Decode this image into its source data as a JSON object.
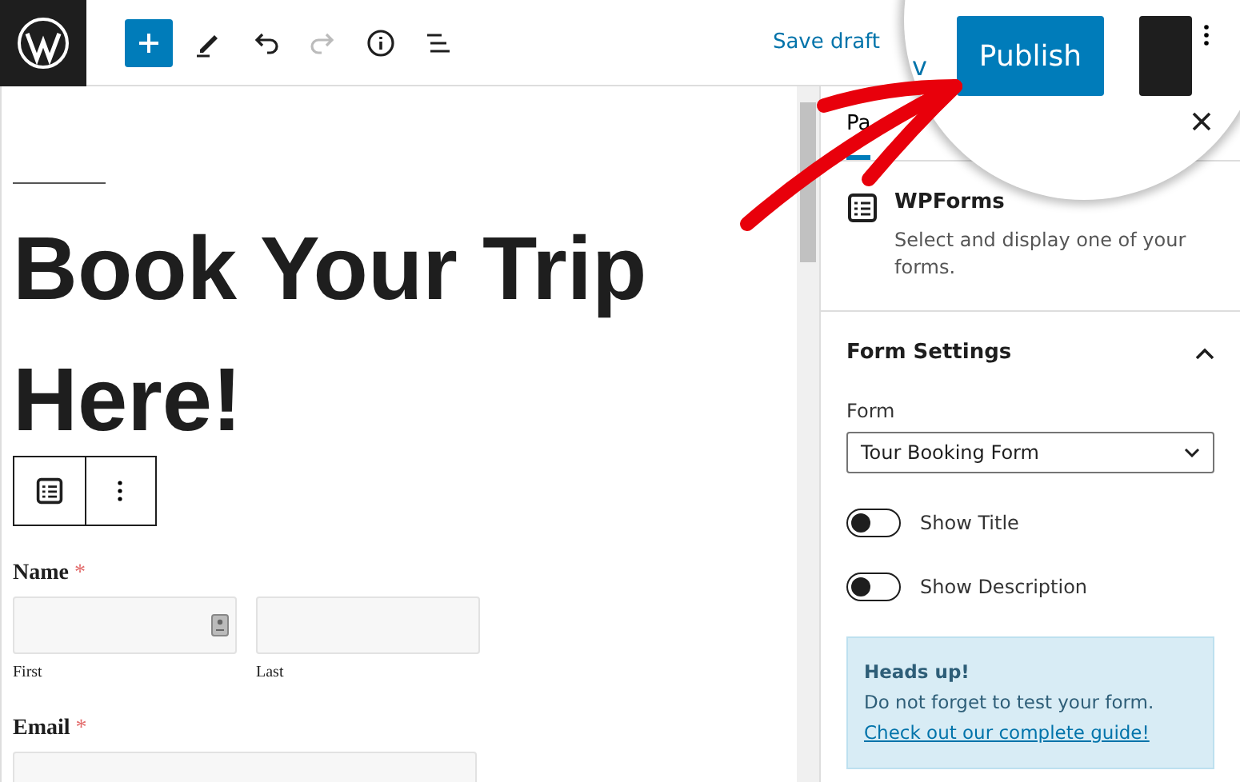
{
  "topbar": {
    "tools": [
      {
        "kind": "add"
      },
      {
        "kind": "edit"
      },
      {
        "kind": "undo",
        "disabled": false
      },
      {
        "kind": "redo",
        "disabled": true
      },
      {
        "kind": "info"
      },
      {
        "kind": "outline"
      }
    ],
    "save_draft": "Save draft"
  },
  "magnifier": {
    "preview_fragment": "v",
    "publish": "Publish"
  },
  "editor": {
    "heading": "Book Your Trip Here!",
    "fields": [
      {
        "label": "Name",
        "required_mark": "*",
        "kind": "name",
        "sublabels": [
          "First",
          "Last"
        ]
      },
      {
        "label": "Email",
        "required_mark": "*",
        "kind": "single"
      }
    ]
  },
  "sidebar": {
    "tab": {
      "label": "Pa",
      "selected": true
    },
    "block": {
      "title": "WPForms",
      "description": "Select and display one of your forms."
    },
    "panel": {
      "title": "Form Settings",
      "expanded": true,
      "form_label": "Form",
      "form_value": "Tour Booking Form",
      "toggles": [
        {
          "label": "Show Title",
          "on": false
        },
        {
          "label": "Show Description",
          "on": false
        }
      ],
      "notice": {
        "title": "Heads up!",
        "text": "Do not forget to test your form.",
        "link": "Check out our complete guide!"
      }
    }
  }
}
